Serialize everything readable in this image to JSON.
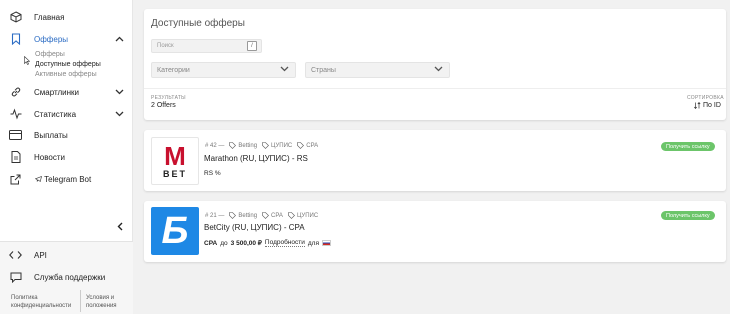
{
  "sidebar": {
    "items": [
      {
        "label": "Главная",
        "icon": "cube-icon"
      },
      {
        "label": "Офферы",
        "icon": "bookmark-icon",
        "active": true
      },
      {
        "label": "Смартлинки",
        "icon": "link-icon"
      },
      {
        "label": "Статистика",
        "icon": "activity-icon"
      },
      {
        "label": "Выплаты",
        "icon": "credit-card-icon"
      },
      {
        "label": "Новости",
        "icon": "document-icon"
      },
      {
        "label": "Telegram Bot",
        "icon": "external-link-icon"
      }
    ],
    "subitems": [
      "Офферы",
      "Доступные офферы",
      "Активные офферы"
    ],
    "bottom": {
      "api_label": "API",
      "support_label": "Служба поддержки",
      "privacy_line1": "Политика",
      "privacy_line2": "конфиденциальности",
      "terms_line1": "Условия и",
      "terms_line2": "положения"
    }
  },
  "filters": {
    "title": "Доступные офферы",
    "search_placeholder": "Поиск",
    "search_shortcut": "/",
    "categories_placeholder": "Категории",
    "countries_placeholder": "Страны"
  },
  "results": {
    "label": "РЕЗУЛЬТАТЫ",
    "count": "2 Offers",
    "sort_label": "СОРТИРОВКА",
    "sort_value": "По ID"
  },
  "offers": [
    {
      "id": "# 42 —",
      "tags": [
        "Betting",
        "ЦУПИС",
        "CPA"
      ],
      "name": "Marathon (RU, ЦУПИС) - RS",
      "rate": "RS %",
      "button": "Получить ссылку",
      "logo_text_top": "M",
      "logo_text_bottom": "BET",
      "logo_color": "#c8102e"
    },
    {
      "id": "# 21 —",
      "tags": [
        "Betting",
        "CPA",
        "ЦУПИС"
      ],
      "name": "BetCity (RU, ЦУПИС) - CPA",
      "rate_prefix": "CPA",
      "rate_middle": "до",
      "rate_amount": "3 500,00 ₽",
      "rate_details": "Подробности",
      "rate_suffix": "для",
      "button": "Получить ссылку",
      "logo_text": "Б",
      "logo_color": "#1e88e5"
    }
  ],
  "colors": {
    "accent": "#2b6cc4",
    "button_green": "#6cc56a"
  }
}
